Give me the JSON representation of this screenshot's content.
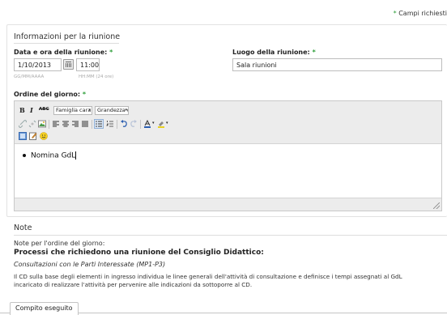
{
  "required_note": {
    "star": "*",
    "text": "Campi richiesti"
  },
  "meeting": {
    "legend": "Informazioni per la riunione",
    "date_label": "Data e ora della riunione:",
    "date_value": "1/10/2013",
    "date_hint": "GG/MM/AAAA",
    "time_value": "11:00",
    "time_hint": "HH:MM (24 ore)",
    "place_label": "Luogo della riunione:",
    "place_value": "Sala riunioni",
    "required_star": "*"
  },
  "agenda": {
    "label": "Ordine del giorno:",
    "toolbar": {
      "bold": "B",
      "italic": "I",
      "strike": "ABC",
      "font_family": "Famiglia cara",
      "font_size": "Grandezza c"
    },
    "items": [
      "Nomina GdL"
    ]
  },
  "notes": {
    "title": "Note",
    "intro": "Note per l'ordine del giorno:",
    "heading": "Processi che richiedono una riunione del Consiglio Didattico:",
    "subheading": "Consultazioni con le Parti Interessate (MP1-P3)",
    "body_line1": "Il CD sulla base degli elementi in ingresso individua le linee generali dell'attività di consultazione e definisce i tempi assegnati al GdL",
    "body_line2": "incaricato di realizzare l'attività per pervenire alle indicazioni da sottoporre al CD."
  },
  "tab": {
    "label": "Compito eseguito"
  },
  "colors": {
    "required": "#2e9e3a",
    "toolbar_bg": "#ececec",
    "border": "#bdbdbd"
  }
}
